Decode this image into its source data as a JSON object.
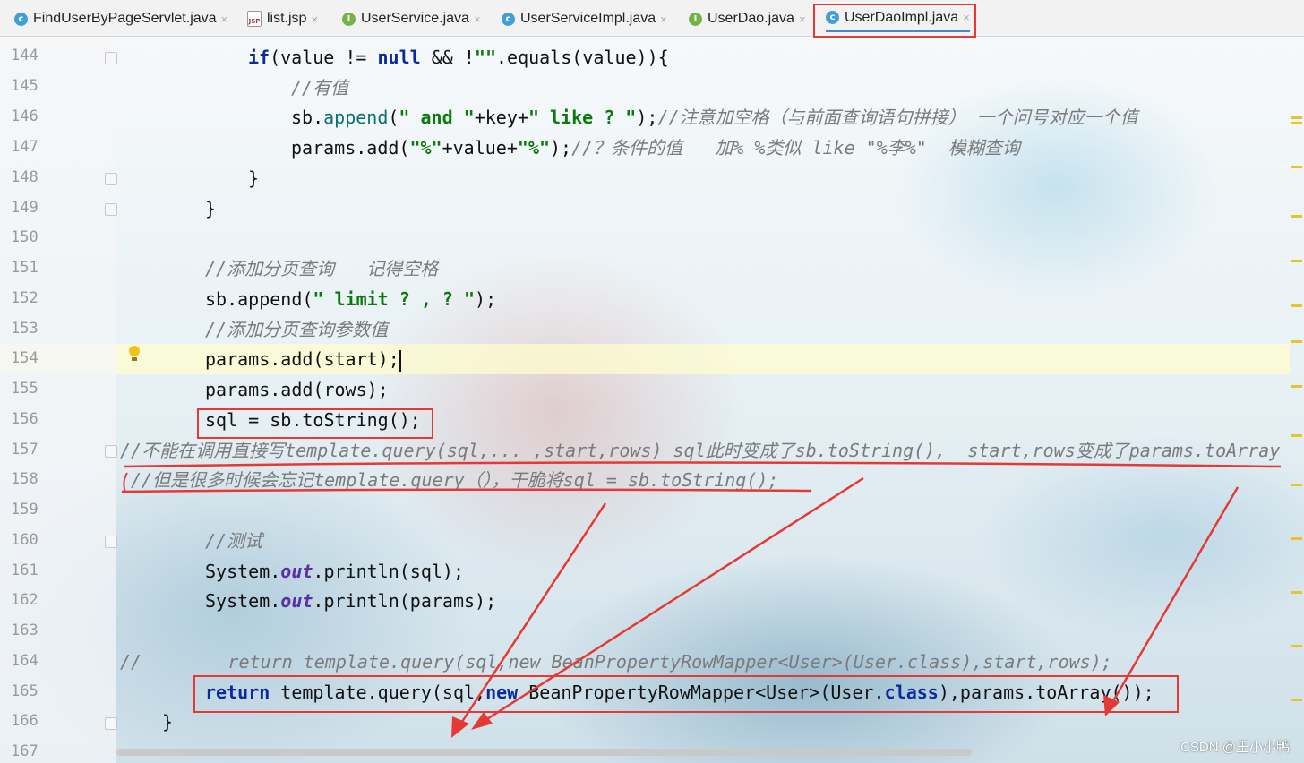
{
  "tabs": [
    {
      "label": "FindUserByPageServlet.java",
      "icon": "class-icon"
    },
    {
      "label": "list.jsp",
      "icon": "jsp-icon"
    },
    {
      "label": "UserService.java",
      "icon": "interface-icon"
    },
    {
      "label": "UserServiceImpl.java",
      "icon": "class-icon"
    },
    {
      "label": "UserDao.java",
      "icon": "interface-icon"
    },
    {
      "label": "UserDaoImpl.java",
      "icon": "class-icon"
    }
  ],
  "close_glyph": "×",
  "line_numbers": [
    "144",
    "145",
    "146",
    "147",
    "148",
    "149",
    "150",
    "151",
    "152",
    "153",
    "154",
    "155",
    "156",
    "157",
    "158",
    "159",
    "160",
    "161",
    "162",
    "163",
    "164",
    "165",
    "166",
    "167"
  ],
  "code": {
    "l144_kw1": "if",
    "l144_a": "(value != ",
    "l144_kw2": "null",
    "l144_b": " && !",
    "l144_str": "\"\"",
    "l144_c": ".equals(value)){",
    "l145_cm": "//有值",
    "l146_a": "sb.",
    "l146_meth": "append",
    "l146_b": "(",
    "l146_s1": "\" and \"",
    "l146_c": "+key+",
    "l146_s2": "\" like ? \"",
    "l146_d": ");",
    "l146_cm": "//注意加空格（与前面查询语句拼接） 一个问号对应一个值",
    "l147_a": "params.add(",
    "l147_s1": "\"%\"",
    "l147_b": "+value+",
    "l147_s2": "\"%\"",
    "l147_c": ");",
    "l147_cm": "//？条件的值   加% %类似 like \"%李%\"  模糊查询",
    "l148": "}",
    "l149": "}",
    "l151_cm": "//添加分页查询   记得空格",
    "l152_a": "sb.append(",
    "l152_s": "\" limit ? , ? \"",
    "l152_b": ");",
    "l153_cm": "//添加分页查询参数值",
    "l154": "params.add(start);",
    "l155": "params.add(rows);",
    "l156": "sql = sb.toString();",
    "l157_cm": "//不能在调用直接写template.query(sql,... ,start,rows) sql此时变成了sb.toString(),  start,rows变成了params.toArray",
    "l158_cm": "//但是很多时候会忘记template.query（），干脆将sql = sb.toString();",
    "l160_cm": "//测试",
    "l161_a": "System.",
    "l161_fld": "out",
    "l161_b": ".println(sql);",
    "l162_a": "System.",
    "l162_fld": "out",
    "l162_b": ".println(params);",
    "l164_cm": "//        return template.query(sql,new BeanPropertyRowMapper<User>(User.class),start,rows);",
    "l165_kw1": "return",
    "l165_a": " template.query(sql,",
    "l165_kw2": "new",
    "l165_b": " BeanPropertyRowMapper<User>(User.",
    "l165_kw3": "class",
    "l165_c": "),params.toArray());",
    "l166": "}"
  },
  "watermark": "CSDN @王小小鸭",
  "colors": {
    "keyword": "#0b2a9e",
    "string": "#0a7a0a",
    "comment": "#7b7b7b",
    "annotation": "#e53935",
    "current_line": "#fffccd"
  }
}
